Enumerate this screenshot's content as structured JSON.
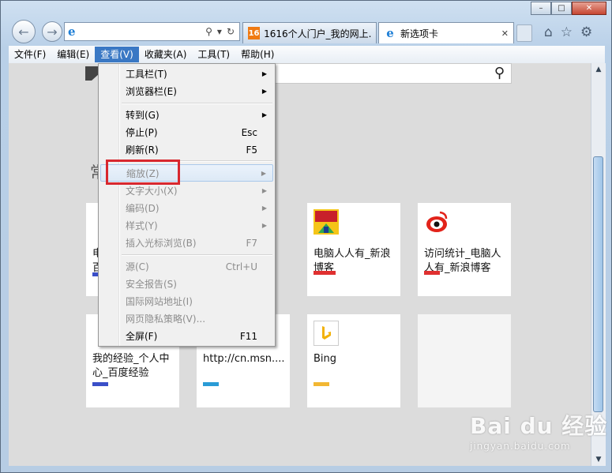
{
  "window": {
    "caption": {
      "minimize": "▭",
      "maximize": "□",
      "close": "✕"
    }
  },
  "tabs": [
    {
      "title": "1616个人门户_我的网上...",
      "icon": "1616-favicon",
      "active": false
    },
    {
      "title": "新选项卡",
      "icon": "ie-favicon",
      "active": true
    }
  ],
  "address": {
    "icons": [
      "search-icon",
      "dropdown-icon",
      "refresh-icon"
    ]
  },
  "menubar": {
    "items": [
      "文件(F)",
      "编辑(E)",
      "查看(V)",
      "收藏夹(A)",
      "工具(T)",
      "帮助(H)"
    ],
    "open_index": 2
  },
  "view_menu": {
    "items": [
      {
        "label": "工具栏(T)",
        "shortcut": "",
        "submenu": true,
        "disabled": false
      },
      {
        "label": "浏览器栏(E)",
        "shortcut": "",
        "submenu": true,
        "disabled": false
      },
      {
        "label": "转到(G)",
        "shortcut": "",
        "submenu": true,
        "disabled": false
      },
      {
        "label": "停止(P)",
        "shortcut": "Esc",
        "submenu": false,
        "disabled": false
      },
      {
        "label": "刷新(R)",
        "shortcut": "F5",
        "submenu": false,
        "disabled": false
      },
      {
        "label": "缩放(Z)",
        "shortcut": "",
        "submenu": true,
        "disabled": true
      },
      {
        "label": "文字大小(X)",
        "shortcut": "",
        "submenu": true,
        "disabled": true
      },
      {
        "label": "编码(D)",
        "shortcut": "",
        "submenu": true,
        "disabled": true
      },
      {
        "label": "样式(Y)",
        "shortcut": "",
        "submenu": true,
        "disabled": true
      },
      {
        "label": "插入光标浏览(B)",
        "shortcut": "F7",
        "submenu": false,
        "disabled": true
      },
      {
        "label": "源(C)",
        "shortcut": "Ctrl+U",
        "submenu": false,
        "disabled": true
      },
      {
        "label": "安全报告(S)",
        "shortcut": "",
        "submenu": false,
        "disabled": true
      },
      {
        "label": "国际网站地址(I)",
        "shortcut": "",
        "submenu": false,
        "disabled": true
      },
      {
        "label": "网页隐私策略(V)...",
        "shortcut": "",
        "submenu": false,
        "disabled": true
      },
      {
        "label": "全屏(F)",
        "shortcut": "F11",
        "submenu": false,
        "disabled": false
      }
    ]
  },
  "content": {
    "section_heading_partial": "常",
    "tiles": [
      {
        "title": "电脑人人有_新浪博客",
        "bar_color": "#e03030",
        "icon": "sina-blog-icon"
      },
      {
        "title": "访问统计_电脑人人有_新浪博客",
        "bar_color": "#e03030",
        "icon": "sina-weibo-icon"
      },
      {
        "title": "我的经验_个人中心_百度经验",
        "bar_color": "#3a4fc8",
        "icon": "baidu-icon"
      },
      {
        "title": "http://cn.msn....",
        "bar_color": "#2a9bd6",
        "icon": "msn-icon"
      },
      {
        "title": "Bing",
        "bar_color": "#f2b733",
        "icon": "bing-icon"
      },
      {
        "title": "",
        "bar_color": "",
        "icon": ""
      }
    ],
    "partial_tile_bars": [
      "#3a4fc8"
    ],
    "partial_tile_text": [
      "电",
      "百"
    ]
  },
  "watermark": {
    "brand": "Bai du 经验",
    "url": "jingyan.baidu.com"
  },
  "colors": {
    "menu_highlight": "#3a78c4",
    "annotation_box": "#d8282f"
  }
}
